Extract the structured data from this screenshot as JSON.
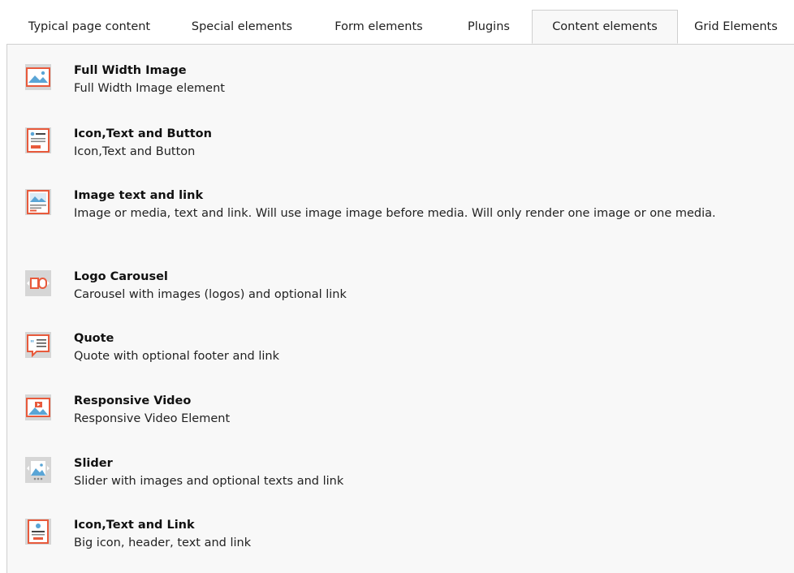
{
  "tabs": [
    {
      "label": "Typical page content"
    },
    {
      "label": "Special elements"
    },
    {
      "label": "Form elements"
    },
    {
      "label": "Plugins"
    },
    {
      "label": "Content elements",
      "active": true
    },
    {
      "label": "Grid Elements"
    }
  ],
  "colors": {
    "accent": "#e85a3c",
    "icon_bg": "#d6d6d6",
    "panel_bg": "#f8f8f8"
  },
  "items": [
    {
      "title": "Full Width Image",
      "description": "Full Width Image element",
      "icon": "full-width-image-icon"
    },
    {
      "title": "Icon,Text and Button",
      "description": "Icon,Text and Button",
      "icon": "icon-text-button-icon"
    },
    {
      "title": "Image text and link",
      "description": "Image or media, text and link. Will use image image before media. Will only render one image or one media.",
      "icon": "image-text-link-icon"
    },
    {
      "title": "Logo Carousel",
      "description": "Carousel with images (logos) and optional link",
      "icon": "logo-carousel-icon"
    },
    {
      "title": "Quote",
      "description": "Quote with optional footer and link",
      "icon": "quote-icon"
    },
    {
      "title": "Responsive Video",
      "description": "Responsive Video Element",
      "icon": "responsive-video-icon"
    },
    {
      "title": "Slider",
      "description": "Slider with images and optional texts and link",
      "icon": "slider-icon"
    },
    {
      "title": "Icon,Text and Link",
      "description": "Big icon, header, text and link",
      "icon": "icon-text-link-icon"
    }
  ]
}
